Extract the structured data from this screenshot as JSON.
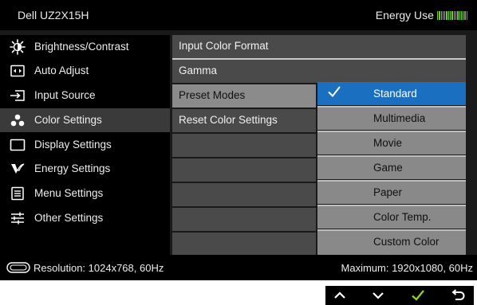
{
  "header": {
    "model": "Dell UZ2X15H",
    "energy_label": "Energy Use",
    "energy_level": 0.88
  },
  "sidebar": {
    "items": [
      {
        "label": "Brightness/Contrast",
        "icon": "brightness-icon"
      },
      {
        "label": "Auto Adjust",
        "icon": "auto-adjust-icon"
      },
      {
        "label": "Input Source",
        "icon": "input-source-icon"
      },
      {
        "label": "Color Settings",
        "icon": "color-settings-icon",
        "active": true
      },
      {
        "label": "Display Settings",
        "icon": "display-settings-icon"
      },
      {
        "label": "Energy Settings",
        "icon": "energy-settings-icon"
      },
      {
        "label": "Menu Settings",
        "icon": "menu-settings-icon"
      },
      {
        "label": "Other Settings",
        "icon": "other-settings-icon"
      }
    ]
  },
  "color_settings": {
    "items": [
      {
        "label": "Input Color Format"
      },
      {
        "label": "Gamma"
      },
      {
        "label": "Preset Modes",
        "highlighted": true
      },
      {
        "label": "Reset Color Settings"
      }
    ]
  },
  "preset_modes": {
    "selected": "Standard",
    "options": [
      "Standard",
      "Multimedia",
      "Movie",
      "Game",
      "Paper",
      "Color Temp.",
      "Custom Color"
    ]
  },
  "footer": {
    "resolution": "Resolution: 1024x768, 60Hz",
    "maximum": "Maximum: 1920x1080, 60Hz"
  },
  "nav_buttons": [
    "up-arrow-icon",
    "down-arrow-icon",
    "check-icon",
    "back-icon"
  ],
  "colors": {
    "accent_blue": "#1a6fc0",
    "energy_green": "#6fcf1f",
    "check_green": "#8fd61c"
  }
}
